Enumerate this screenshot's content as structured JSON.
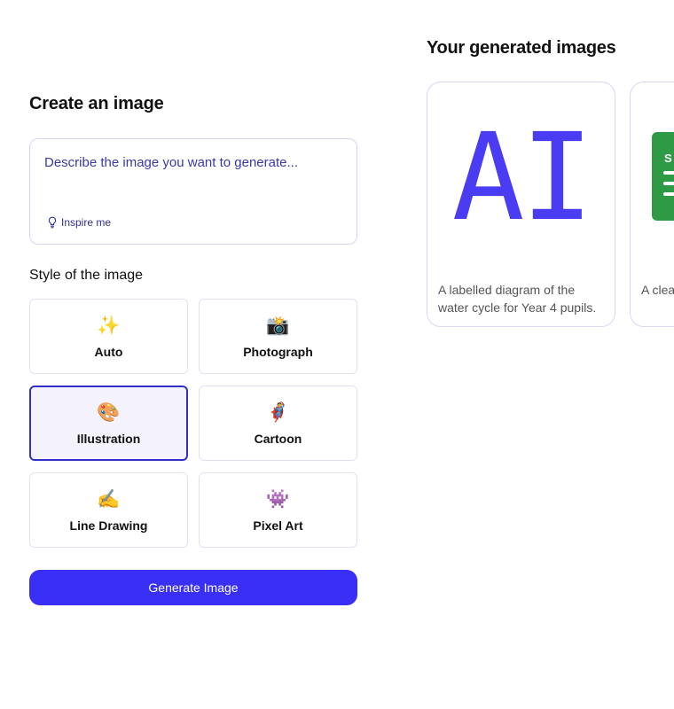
{
  "create": {
    "title": "Create an image",
    "prompt_placeholder": "Describe the image you want to generate...",
    "inspire_label": "Inspire me",
    "style_title": "Style of the image",
    "styles": [
      {
        "emoji": "✨",
        "label": "Auto"
      },
      {
        "emoji": "📸",
        "label": "Photograph"
      },
      {
        "emoji": "🎨",
        "label": "Illustration"
      },
      {
        "emoji": "🦸",
        "label": "Cartoon"
      },
      {
        "emoji": "✍️",
        "label": "Line Drawing"
      },
      {
        "emoji": "👾",
        "label": "Pixel Art"
      }
    ],
    "selected_style": "Illustration",
    "generate_label": "Generate Image"
  },
  "gallery": {
    "title": "Your generated images",
    "items": [
      {
        "thumb_text": "AI",
        "caption": "A labelled diagram of the water cycle for Year 4 pupils."
      },
      {
        "thumb_text": "S",
        "caption": "A clear diagram of a volcano"
      }
    ]
  },
  "colors": {
    "accent": "#3a2ff5",
    "selected_border": "#3330c7",
    "selected_bg": "#f4f3fd",
    "ai_glyph": "#4a3cf2",
    "sheet_green": "#2f9a45"
  },
  "icons": {
    "inspire": "lightbulb-icon"
  }
}
